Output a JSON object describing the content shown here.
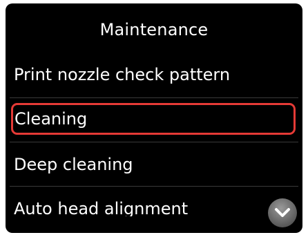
{
  "header": {
    "title": "Maintenance"
  },
  "menu": {
    "items": [
      {
        "label": "Print nozzle check pattern",
        "selected": false
      },
      {
        "label": "Cleaning",
        "selected": true
      },
      {
        "label": "Deep cleaning",
        "selected": false
      },
      {
        "label": "Auto head alignment",
        "selected": false
      }
    ]
  },
  "controls": {
    "scroll_icon": "chevron-down-icon"
  },
  "colors": {
    "selection_border": "#e53a36",
    "background": "#000000",
    "text": "#ffffff"
  }
}
